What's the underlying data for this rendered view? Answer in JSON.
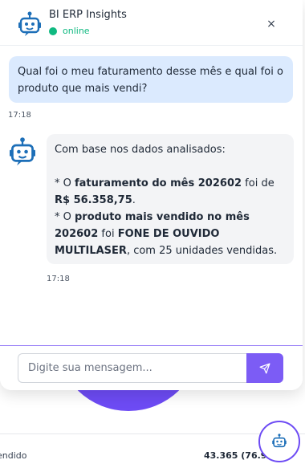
{
  "background": {
    "row_label": "endido",
    "row_value": "43.365 (76.9..."
  },
  "chat": {
    "header": {
      "title": "BI ERP Insights",
      "status": "online",
      "close_label": "×"
    },
    "messages": {
      "user": {
        "text": "Qual foi o meu faturamento desse mês e qual foi o produto que mais vendi?",
        "time": "17:18"
      },
      "bot": {
        "intro": "Com base nos dados analisados:",
        "line1_prefix": "* O ",
        "line1_bold1": "faturamento do mês 202602",
        "line1_mid": " foi de ",
        "line1_bold2": "R$ 56.358,75",
        "line1_suffix": ".",
        "line2_prefix": "* O ",
        "line2_bold1": "produto mais vendido no mês 202602",
        "line2_mid": " foi ",
        "line2_bold2": "FONE DE OUVIDO MULTILASER",
        "line2_suffix": ", com 25 unidades vendidas.",
        "time": "17:18"
      }
    },
    "input": {
      "placeholder": "Digite sua mensagem..."
    }
  },
  "colors": {
    "accent": "#6d4bf4",
    "online": "#10b981",
    "user_bubble": "#dbeafe",
    "bot_bubble": "#f3f4f6"
  },
  "icons": {
    "header": "robot-icon",
    "bot_avatar": "robot-icon",
    "send": "send-icon",
    "fab": "robot-icon",
    "close": "close-icon"
  }
}
